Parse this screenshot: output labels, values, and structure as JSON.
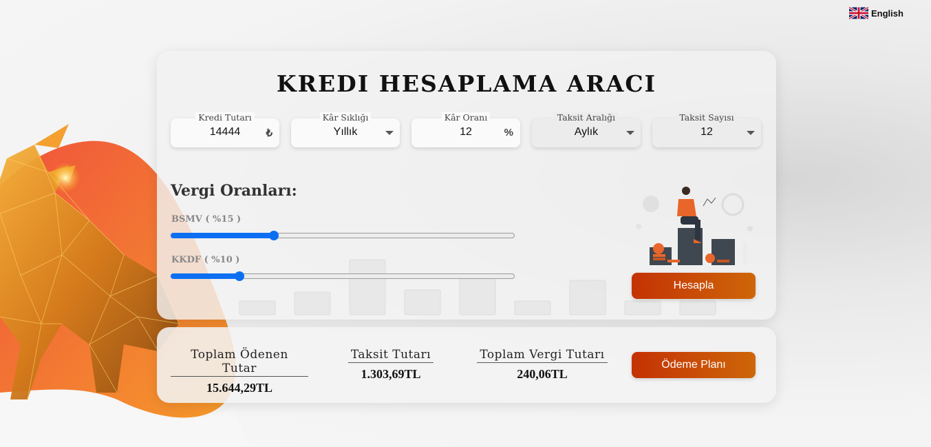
{
  "language": {
    "label": "English"
  },
  "calculator": {
    "title": "KREDI HESAPLAMA ARACI",
    "fields": [
      {
        "label": "Kredi Tutarı",
        "value": "14444",
        "suffix": "₺"
      },
      {
        "label": "Kâr Sıklığı",
        "value": "Yıllık"
      },
      {
        "label": "Kâr Oranı",
        "value": "12",
        "suffix": "%"
      },
      {
        "label": "Taksit Aralığı",
        "value": "Aylık"
      },
      {
        "label": "Taksit Sayısı",
        "value": "12"
      }
    ],
    "tax_title": "Vergi Oranları:",
    "sliders": [
      {
        "label": "BSMV ( %15 )",
        "fraction": 0.3
      },
      {
        "label": "KKDF ( %10 )",
        "fraction": 0.2
      }
    ],
    "calculate_label": "Hesapla"
  },
  "results": {
    "total_paid": {
      "label": "Toplam Ödenen Tutar",
      "value": "15.644,29TL"
    },
    "installment": {
      "label": "Taksit Tutarı",
      "value": "1.303,69TL"
    },
    "total_tax": {
      "label": "Toplam Vergi Tutarı",
      "value": "240,06TL"
    },
    "plan_label": "Ödeme Planı"
  },
  "colors": {
    "accent": "#0c6ff2",
    "button_start": "#c43205",
    "button_end": "#ce6608",
    "brand_orange": "#f07a2a"
  }
}
